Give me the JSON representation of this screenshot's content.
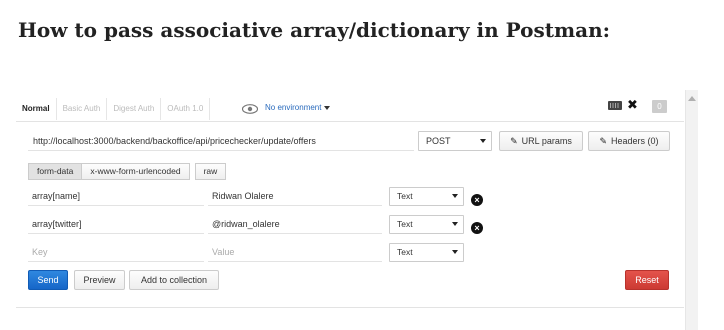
{
  "heading": "How to pass associative array/dictionary in Postman:",
  "auth_tabs": [
    "Normal",
    "Basic Auth",
    "Digest Auth",
    "OAuth 1.0"
  ],
  "environment": {
    "label": "No environment"
  },
  "toolbar": {
    "badge_count": "0"
  },
  "request": {
    "url": "http://localhost:3000/backend/backoffice/api/pricechecker/update/offers",
    "method": "POST",
    "url_params_label": "URL params",
    "headers_label": "Headers (0)"
  },
  "body_tabs": [
    "form-data",
    "x-www-form-urlencoded",
    "raw"
  ],
  "form_rows": [
    {
      "key": "array[name]",
      "value": "Ridwan Olalere",
      "type": "Text"
    },
    {
      "key": "array[twitter]",
      "value": "@ridwan_olalere",
      "type": "Text"
    }
  ],
  "new_row": {
    "key_placeholder": "Key",
    "value_placeholder": "Value",
    "type": "Text"
  },
  "actions": {
    "send": "Send",
    "preview": "Preview",
    "add_to_collection": "Add to collection",
    "reset": "Reset"
  },
  "colors": {
    "send": "#1e72d2",
    "reset": "#d9443d",
    "env_link": "#2a6bbd"
  }
}
